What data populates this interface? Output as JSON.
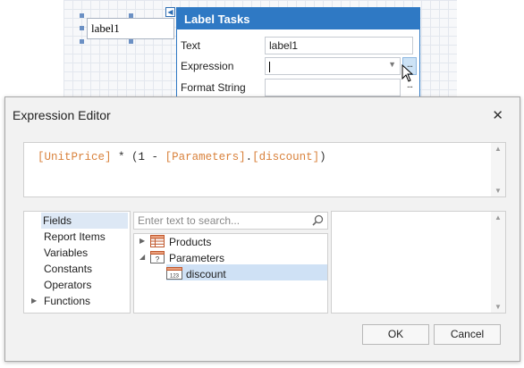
{
  "designer": {
    "label_text": "label1"
  },
  "label_tasks": {
    "title": "Label Tasks",
    "rows": [
      {
        "label": "Text",
        "value": "label1"
      },
      {
        "label": "Expression",
        "value": ""
      },
      {
        "label": "Format String",
        "value": ""
      }
    ],
    "ellipsis": "..."
  },
  "dialog": {
    "title": "Expression Editor",
    "close_glyph": "✕",
    "expression": {
      "t1": "[UnitPrice]",
      "t2": " * (",
      "t3": "1",
      "t4": " - ",
      "t5": "[Parameters]",
      "t6": ".",
      "t7": "[discount]",
      "t8": ")"
    },
    "categories": [
      "Fields",
      "Report Items",
      "Variables",
      "Constants",
      "Operators",
      "Functions"
    ],
    "selected_category": "Fields",
    "search": {
      "placeholder": "Enter text to search..."
    },
    "tree": {
      "products": "Products",
      "parameters": "Parameters",
      "discount": "discount"
    },
    "buttons": {
      "ok": "OK",
      "cancel": "Cancel"
    }
  },
  "colors": {
    "accent": "#2f79c4",
    "field_token": "#d9823c",
    "selection": "#cfe1f5"
  }
}
